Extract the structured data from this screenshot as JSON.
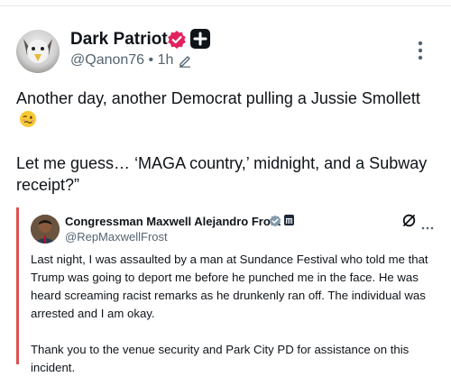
{
  "post": {
    "author_name": "Dark Patriot",
    "handle": "@Qanon76",
    "separator": "•",
    "time": "1h",
    "text_line1": "Another day, another Democrat pulling a Jussie Smollett",
    "text_line2": "Let me guess… ‘MAGA country,’ midnight, and a Subway receipt?”"
  },
  "quote": {
    "author_name": "Congressman Maxwell Alejandro Frost",
    "handle": "@RepMaxwellFrost",
    "more_glyph": "···",
    "para1": "Last night, I was assaulted by a man at Sundance Festival who told me that Trump was going to deport me before he punched me in the face. He was heard screaming racist remarks as he drunkenly ran off. The individual was arrested and I am okay.",
    "para2": "Thank you to the venue security and Park City PD for assistance on this incident."
  },
  "icons": {
    "verified": "verified-badge-icon",
    "plus": "plus-badge-icon",
    "edit": "pencil-icon",
    "more": "more-vertical-icon",
    "emoji": "woozy-face-emoji",
    "grok": "grok-icon",
    "quote_more": "more-horizontal-icon"
  },
  "colors": {
    "verified_badge": "#e0245e",
    "quote_bar": "#d9534f",
    "text_primary": "#0f1419",
    "text_secondary": "#536471",
    "q_verified": "#829aab"
  }
}
